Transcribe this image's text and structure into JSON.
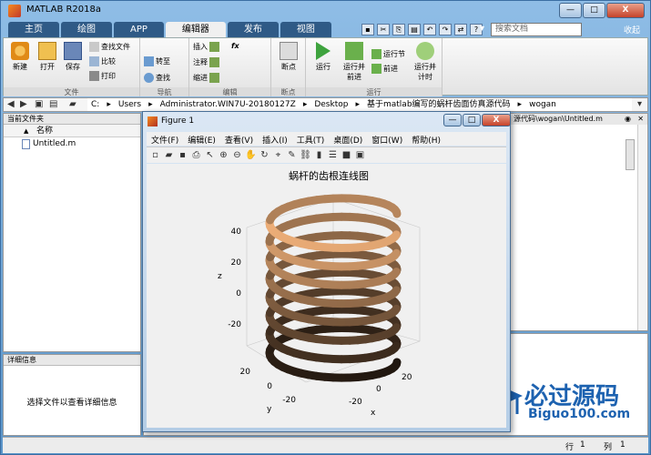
{
  "window": {
    "title": "MATLAB R2018a",
    "minimize": "—",
    "maximize": "□",
    "close": "X"
  },
  "tabs": [
    "主页",
    "绘图",
    "APP",
    "编辑器",
    "发布",
    "视图"
  ],
  "search": {
    "placeholder": "搜索文档",
    "collapse": "收起"
  },
  "ribbon": {
    "file": {
      "name": "文件",
      "new": "新建",
      "open": "打开",
      "save": "保存",
      "find_files": "查找文件",
      "compare": "比较",
      "print": "打印"
    },
    "nav": {
      "name": "导航",
      "goto": "转至",
      "find": "查找"
    },
    "edit": {
      "name": "编辑",
      "insert": "插入",
      "comment": "注释",
      "indent": "缩进",
      "fx": "fx"
    },
    "breakpoints": {
      "name": "断点",
      "label": "断点"
    },
    "run": {
      "name": "运行",
      "run": "运行",
      "run_advance": "运行并\n前进",
      "run_section": "运行节",
      "advance": "前进",
      "run_time": "运行并\n计时"
    }
  },
  "address": {
    "parts": [
      "C:",
      "Users",
      "Administrator.WIN7U-20180127Z",
      "Desktop",
      "基于matlab编写的蜗杆齿面仿真源代码",
      "wogan"
    ]
  },
  "left_panel": {
    "title": "当前文件夹",
    "col_name": "名称",
    "sort": "▲",
    "files": [
      "Untitled.m"
    ]
  },
  "detail_panel": {
    "title": "详细信息",
    "text": "选择文件以查看详细信息"
  },
  "editor": {
    "path": "源代码\\wogan\\Untitled.m"
  },
  "status": {
    "row_label": "行",
    "row": "1",
    "col_label": "列",
    "col": "1"
  },
  "figure": {
    "title": "Figure 1",
    "menus": [
      "文件(F)",
      "编辑(E)",
      "查看(V)",
      "插入(I)",
      "工具(T)",
      "桌面(D)",
      "窗口(W)",
      "帮助(H)"
    ],
    "plot_title": "蜗杆的齿根连线图",
    "xlabel": "x",
    "ylabel": "y",
    "zlabel": "z",
    "z_ticks": [
      "40",
      "20",
      "0",
      "-20"
    ],
    "y_ticks": [
      "20",
      "0",
      "-20"
    ],
    "x_ticks": [
      "-20",
      "0",
      "20"
    ]
  },
  "watermark": {
    "text": "必过源码",
    "url": "Biguo100.com"
  },
  "colors": {
    "ribbon_bg": "#f0f0f0",
    "title_bg": "#6fa7d6",
    "coil_light": "#f5b47c",
    "coil_dark": "#1a120c"
  },
  "chart_data": {
    "type": "surface",
    "title": "蜗杆的齿根连线图",
    "xlabel": "x",
    "ylabel": "y",
    "zlabel": "z",
    "xlim": [
      -30,
      30
    ],
    "ylim": [
      -30,
      30
    ],
    "zlim": [
      -35,
      50
    ],
    "z_ticks": [
      -20,
      0,
      20,
      40
    ],
    "turns": 8,
    "radius": 25,
    "colormap": "copper"
  }
}
